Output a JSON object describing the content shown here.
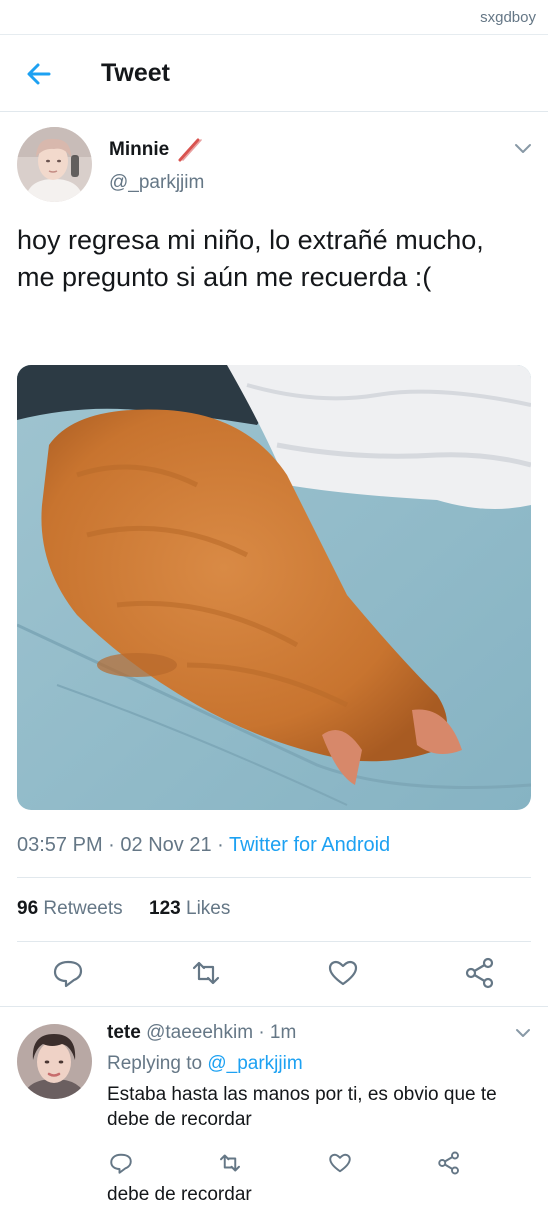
{
  "watermark": "sxgdboy",
  "header": {
    "title": "Tweet"
  },
  "tweet": {
    "author_name": "Minnie",
    "author_handle": "@_parkjjim",
    "text": "hoy regresa mi niño, lo extrañé mucho, me pregunto si aún me recuerda :(",
    "time": "03:57 PM",
    "date": "02 Nov 21",
    "source": "Twitter for Android",
    "retweet_count": "96",
    "retweet_label": "Retweets",
    "like_count": "123",
    "like_label": "Likes"
  },
  "reply": {
    "author_name": "tete",
    "author_handle": "@taeeehkim",
    "time": "1m",
    "replying_label": "Replying to",
    "replying_to": "@_parkjjim",
    "text": "Estaba hasta las manos por ti, es obvio que te debe de recordar",
    "cut_text": "debe de recordar"
  },
  "colors": {
    "accent": "#1da1f2",
    "secondary_text": "#657786",
    "divider": "#e1e8ed",
    "primary_text": "#14171a"
  },
  "icons": [
    "back-arrow-icon",
    "pencil-icon",
    "chevron-down-icon",
    "reply-icon",
    "retweet-icon",
    "like-icon",
    "share-icon"
  ]
}
